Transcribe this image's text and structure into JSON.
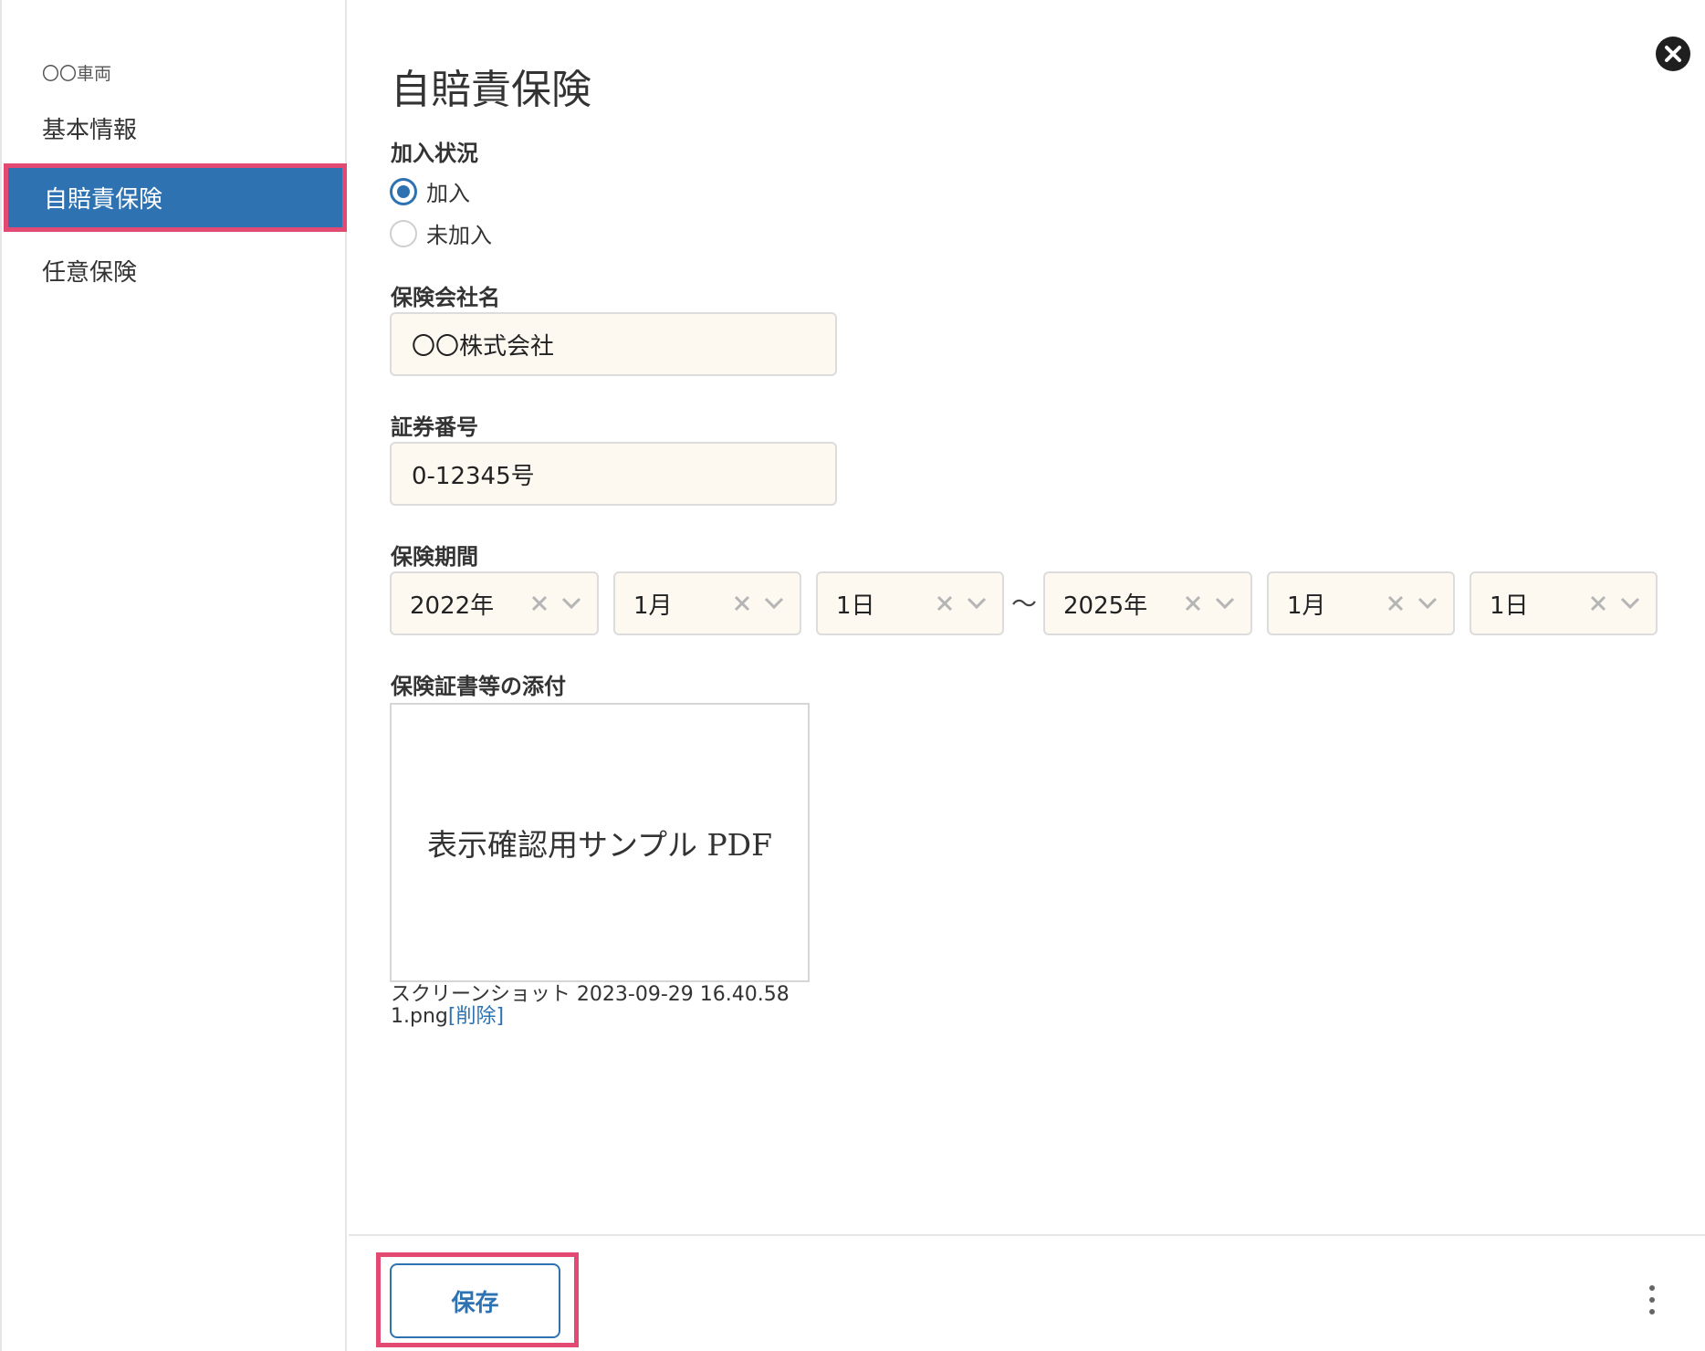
{
  "sidebar": {
    "vehicle_name": "〇〇車両",
    "items": [
      {
        "label": "基本情報",
        "active": false
      },
      {
        "label": "自賠責保険",
        "active": true
      },
      {
        "label": "任意保険",
        "active": false
      }
    ]
  },
  "main": {
    "title": "自賠責保険",
    "enrollment": {
      "label": "加入状況",
      "options": [
        {
          "label": "加入",
          "checked": true
        },
        {
          "label": "未加入",
          "checked": false
        }
      ]
    },
    "insurer": {
      "label": "保険会社名",
      "value": "〇〇株式会社"
    },
    "policy_number": {
      "label": "証券番号",
      "value": "0-12345号"
    },
    "period": {
      "label": "保険期間",
      "separator": "〜",
      "start": {
        "year": "2022年",
        "month": "1月",
        "day": "1日"
      },
      "end": {
        "year": "2025年",
        "month": "1月",
        "day": "1日"
      }
    },
    "attachment": {
      "label": "保険証書等の添付",
      "preview_text": "表示確認用サンプル PDF",
      "filename_line1": "スクリーンショット 2023-09-29 16.40.58",
      "filename_line2": "1.png",
      "delete_label": "[削除]"
    }
  },
  "footer": {
    "save_label": "保存"
  },
  "colors": {
    "accent": "#2e72b2",
    "highlight": "#e24a74",
    "input_bg": "#fdf8f0"
  }
}
